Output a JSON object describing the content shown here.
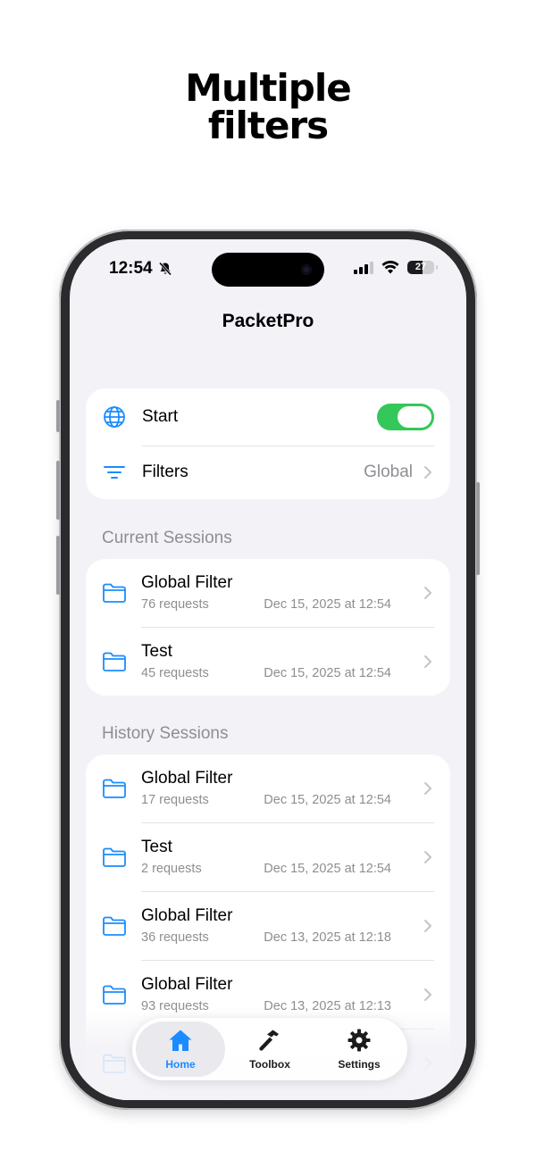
{
  "headline": {
    "line1": "Multiple",
    "line2": "filters"
  },
  "status_bar": {
    "time": "12:54",
    "battery": "27"
  },
  "app": {
    "title": "PacketPro"
  },
  "controls": {
    "start_label": "Start",
    "filters_label": "Filters",
    "filters_value": "Global"
  },
  "current_sessions": {
    "header": "Current Sessions",
    "items": [
      {
        "name": "Global Filter",
        "count": "76 requests",
        "date": "Dec 15, 2025 at 12:54"
      },
      {
        "name": "Test",
        "count": "45 requests",
        "date": "Dec 15, 2025 at 12:54"
      }
    ]
  },
  "history_sessions": {
    "header": "History Sessions",
    "items": [
      {
        "name": "Global Filter",
        "count": "17 requests",
        "date": "Dec 15, 2025 at 12:54"
      },
      {
        "name": "Test",
        "count": "2 requests",
        "date": "Dec 15, 2025 at 12:54"
      },
      {
        "name": "Global Filter",
        "count": "36 requests",
        "date": "Dec 13, 2025 at 12:18"
      },
      {
        "name": "Global Filter",
        "count": "93 requests",
        "date": "Dec 13, 2025 at 12:13"
      }
    ]
  },
  "tabbar": {
    "home": "Home",
    "toolbox": "Toolbox",
    "settings": "Settings"
  },
  "colors": {
    "accent": "#1a8cff",
    "toggle_on": "#34c759",
    "background": "#f2f2f7"
  }
}
